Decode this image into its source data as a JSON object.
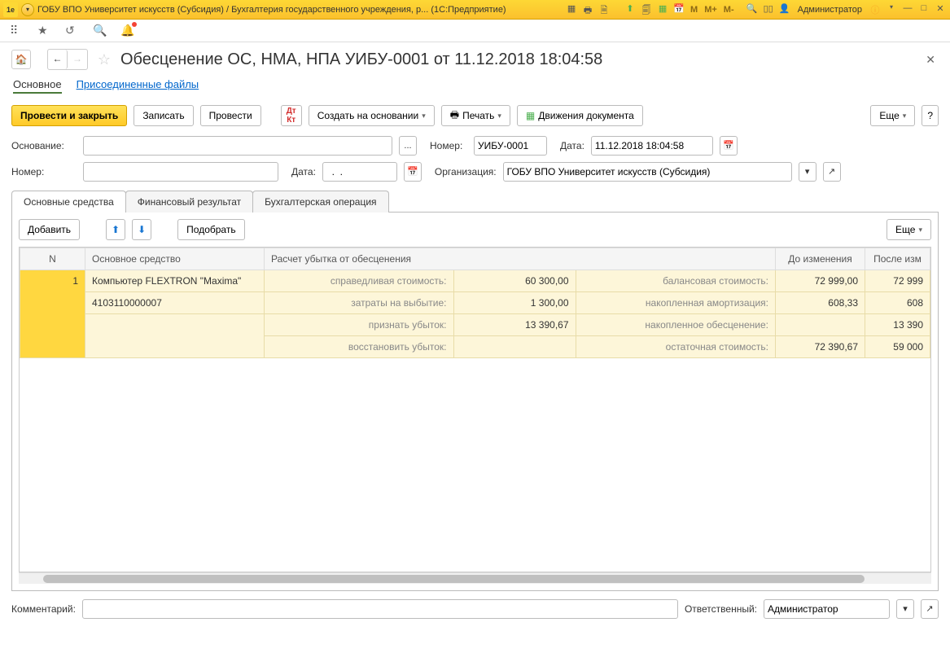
{
  "titlebar": {
    "logo_text": "1e",
    "title": "ГОБУ ВПО Университет искусств (Субсидия) / Бухгалтерия государственного учреждения, р...  (1С:Предприятие)",
    "m": "M",
    "m_plus": "M+",
    "m_minus": "M-",
    "user_label": "Администратор"
  },
  "page": {
    "title": "Обесценение ОС, НМА, НПА УИБУ-0001 от 11.12.2018 18:04:58",
    "tabs": {
      "main": "Основное",
      "files": "Присоединенные файлы"
    },
    "actions": {
      "post_close": "Провести и закрыть",
      "save": "Записать",
      "post": "Провести",
      "create_based": "Создать на основании",
      "print": "Печать",
      "movements": "Движения документа",
      "more": "Еще",
      "help": "?"
    },
    "form": {
      "basis_label": "Основание:",
      "number_label": "Номер:",
      "number_value": "УИБУ-0001",
      "date_label": "Дата:",
      "date_value": "11.12.2018 18:04:58",
      "number2_label": "Номер:",
      "date2_label": "Дата:",
      "date2_value": "  .  .",
      "org_label": "Организация:",
      "org_value": "ГОБУ ВПО Университет искусств (Субсидия)"
    },
    "subtabs": {
      "os": "Основные средства",
      "fin": "Финансовый результат",
      "acc": "Бухгалтерская операция"
    },
    "tab_actions": {
      "add": "Добавить",
      "pick": "Подобрать",
      "more": "Еще"
    },
    "table": {
      "headers": {
        "n": "N",
        "asset": "Основное средство",
        "calc": "Расчет убытка от обесценения",
        "before": "До изменения",
        "after": "После изм"
      },
      "row": {
        "n": "1",
        "asset_name": "Компьютер FLEXTRON \"Maxima\"",
        "asset_code": "4103110000007",
        "fair_value_label": "справедливая стоимость:",
        "fair_value": "60 300,00",
        "disposal_label": "затраты на выбытие:",
        "disposal": "1 300,00",
        "recognize_label": "признать убыток:",
        "recognize": "13 390,67",
        "restore_label": "восстановить убыток:",
        "restore": "",
        "balance_label": "балансовая стоимость:",
        "balance_before": "72 999,00",
        "balance_after": "72 999",
        "amort_label": "накопленная амортизация:",
        "amort_before": "608,33",
        "amort_after": "608",
        "impair_label": "накопленное обесценение:",
        "impair_before": "",
        "impair_after": "13 390",
        "residual_label": "остаточная стоимость:",
        "residual_before": "72 390,67",
        "residual_after": "59 000"
      }
    },
    "comment_label": "Комментарий:",
    "responsible_label": "Ответственный:",
    "responsible_value": "Администратор"
  }
}
